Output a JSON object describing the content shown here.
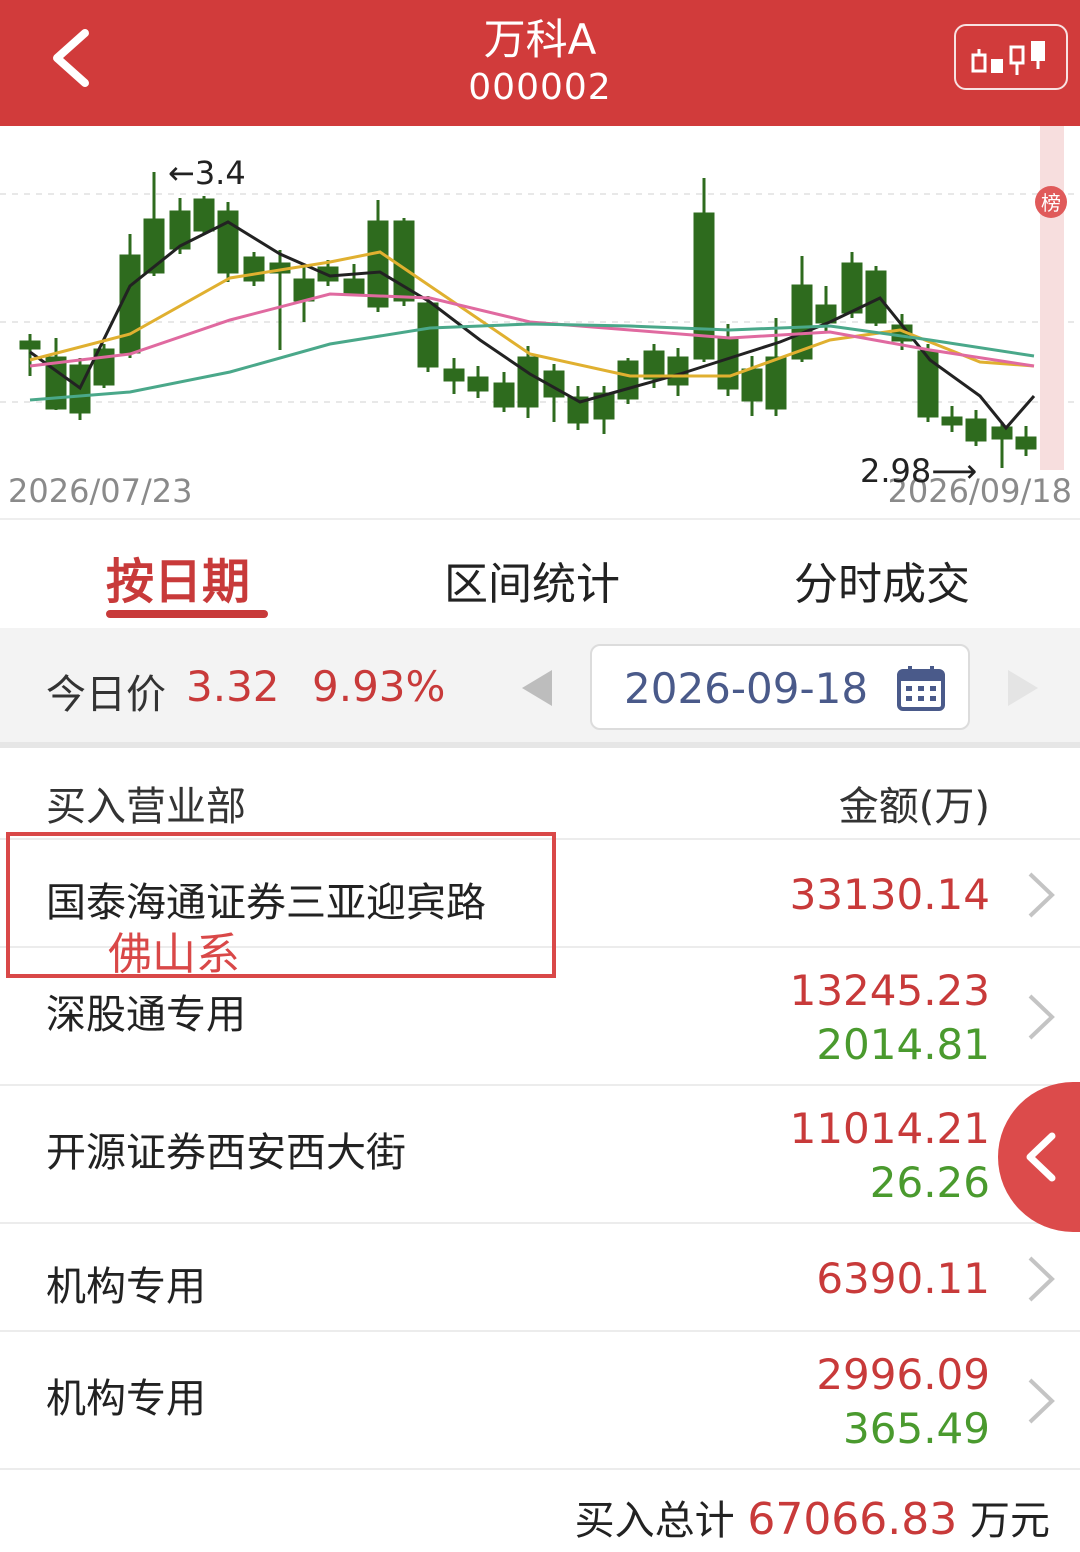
{
  "header": {
    "title": "万科A",
    "code": "000002",
    "back_icon": "back-chevron-icon",
    "kline_icon": "candlestick-icon"
  },
  "chart": {
    "start_date": "2026/07/23",
    "end_date": "2026/09/18",
    "high_label": "3.4",
    "low_label": "2.98",
    "badge": "榜",
    "colors": {
      "up": "#d13b3b",
      "down": "#2e6b1e",
      "ma5": "#222222",
      "ma10": "#e0b030",
      "ma20": "#e06aa0",
      "ma60": "#4aa88a"
    }
  },
  "tabs": [
    {
      "label": "按日期",
      "active": true
    },
    {
      "label": "区间统计",
      "active": false
    },
    {
      "label": "分时成交",
      "active": false
    }
  ],
  "price": {
    "label": "今日价",
    "value": "3.32",
    "change_pct": "9.93%",
    "date": "2026-09-18"
  },
  "table": {
    "col_left": "买入营业部",
    "col_right": "金额(万)",
    "rows": [
      {
        "name": "国泰海通证券三亚迎宾路",
        "buy": "33130.14",
        "sell": ""
      },
      {
        "name": "深股通专用",
        "buy": "13245.23",
        "sell": "2014.81"
      },
      {
        "name": "开源证券西安西大街",
        "buy": "11014.21",
        "sell": "26.26"
      },
      {
        "name": "机构专用",
        "buy": "6390.11",
        "sell": ""
      },
      {
        "name": "机构专用",
        "buy": "2996.09",
        "sell": "365.49"
      }
    ],
    "annotation": "佛山系"
  },
  "total": {
    "label": "买入总计",
    "amount": "67066.83",
    "unit": "万元"
  }
}
